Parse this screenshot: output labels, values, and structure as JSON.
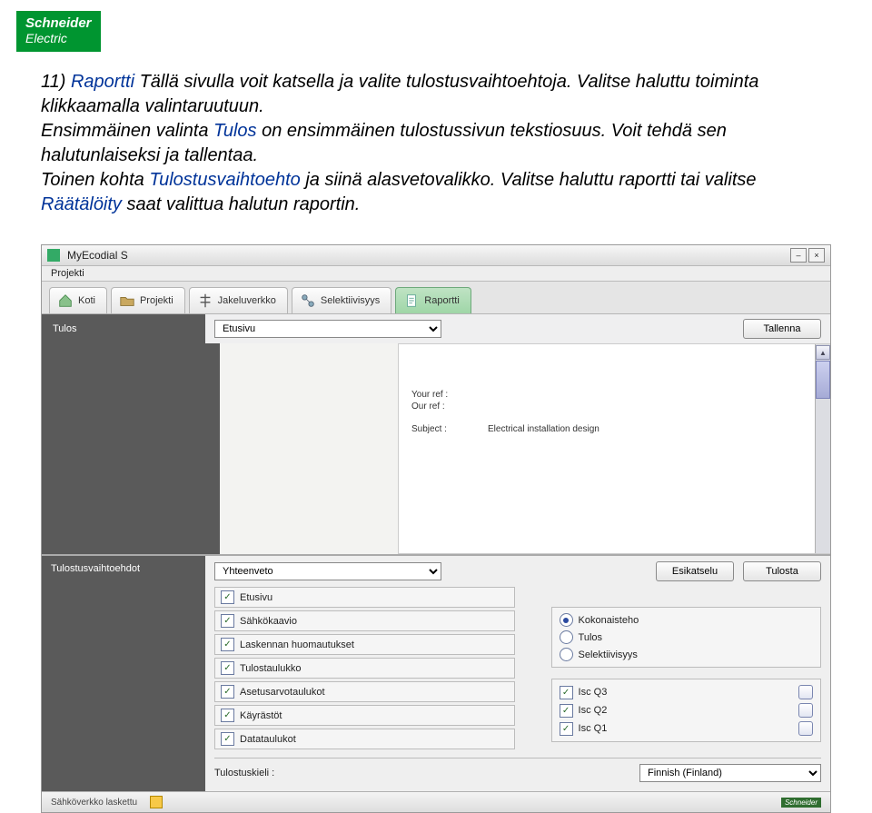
{
  "logo": {
    "line1": "Schneider",
    "line2": "Electric"
  },
  "instructions": {
    "s1a": "11) ",
    "s1b": "Raportti",
    "s1c": " Tällä sivulla voit katsella ja valite tulostusvaihtoehtoja. Valitse haluttu toiminta klikkaamalla valintaruutuun.",
    "s2a": "Ensimmäinen valinta ",
    "s2b": "Tulos",
    "s2c": " on ensimmäinen tulostussivun tekstiosuus. Voit tehdä sen halutunlaiseksi ja tallentaa.",
    "s3a": "Toinen kohta ",
    "s3b": "Tulostusvaihtoehto",
    "s3c": " ja siinä alasvetovalikko. Valitse haluttu raportti tai valitse ",
    "s3d": "Räätälöity",
    "s3e": " saat valittua halutun raportin."
  },
  "app": {
    "title": "MyEcodial S",
    "menu": "Projekti",
    "tabs": {
      "home": "Koti",
      "project": "Projekti",
      "distribution": "Jakeluverkko",
      "selectivity": "Selektiivisyys",
      "report": "Raportti"
    },
    "tulos_label": "Tulos",
    "tulos_value": "Etusivu",
    "save_btn": "Tallenna",
    "preview": {
      "your_ref": "Your ref :",
      "our_ref": "Our ref :",
      "subject_lbl": "Subject :",
      "subject_val": "Electrical installation design"
    },
    "opts_label": "Tulostusvaihtoehdot",
    "opts_select": "Yhteenveto",
    "preview_btn": "Esikatselu",
    "print_btn": "Tulosta",
    "checks": {
      "etusivu": "Etusivu",
      "sahkokaavio": "Sähkökaavio",
      "laskenta": "Laskennan huomautukset",
      "tulostaulukko": "Tulostaulukko",
      "asetus": "Asetusarvotaulukot",
      "kayrastot": "Käyrästöt",
      "datataulukot": "Datataulukot"
    },
    "radios": {
      "kokonaisteho": "Kokonaisteho",
      "tulos": "Tulos",
      "selektiivisyys": "Selektiivisyys"
    },
    "isc": {
      "q3": "Isc Q3",
      "q2": "Isc Q2",
      "q1": "Isc Q1"
    },
    "lang_label": "Tulostuskieli :",
    "lang_value": "Finnish (Finland)",
    "status": "Sähköverkko laskettu"
  }
}
